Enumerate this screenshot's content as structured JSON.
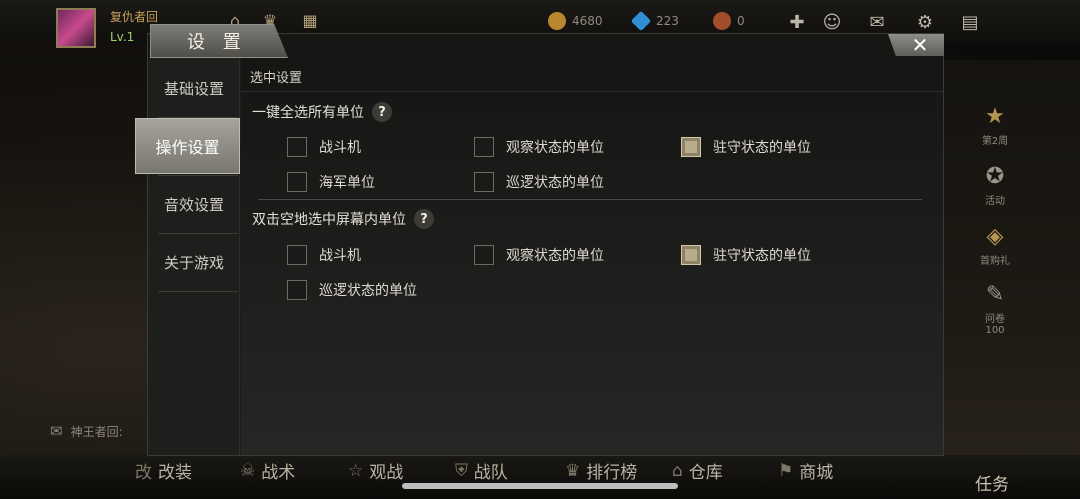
{
  "player": {
    "name": "复仇者回",
    "level": "Lv.1"
  },
  "resources": {
    "gold": "4680",
    "gems": "223",
    "medals": "0"
  },
  "settings": {
    "title": "设 置",
    "close_label": "✕",
    "nav": [
      "基础设置",
      "操作设置",
      "音效设置",
      "关于游戏"
    ],
    "active_nav": "操作设置",
    "section_title": "选中设置",
    "group1": {
      "title": "一键全选所有单位",
      "help": "?",
      "options": [
        {
          "label": "战斗机",
          "checked": false
        },
        {
          "label": "观察状态的单位",
          "checked": false
        },
        {
          "label": "驻守状态的单位",
          "checked": true
        },
        {
          "label": "海军单位",
          "checked": false
        },
        {
          "label": "巡逻状态的单位",
          "checked": false
        }
      ]
    },
    "group2": {
      "title": "双击空地选中屏幕内单位",
      "help": "?",
      "options": [
        {
          "label": "战斗机",
          "checked": false
        },
        {
          "label": "观察状态的单位",
          "checked": false
        },
        {
          "label": "驻守状态的单位",
          "checked": true
        },
        {
          "label": "巡逻状态的单位",
          "checked": false
        }
      ]
    }
  },
  "side": [
    "第2周",
    "活动",
    "首购礼",
    "问卷"
  ],
  "side_count": "100",
  "chat_label": "神王者回:",
  "bottom_nav": [
    {
      "icon": "改",
      "label": "改装"
    },
    {
      "icon": "☠",
      "label": "战术"
    },
    {
      "icon": "☆",
      "label": "观战"
    },
    {
      "icon": "⛨",
      "label": "战队"
    },
    {
      "icon": "♛",
      "label": "排行榜"
    },
    {
      "icon": "⌂",
      "label": "仓库"
    },
    {
      "icon": "⚑",
      "label": "商城"
    }
  ],
  "mission_label": "任务",
  "colors": {
    "accent": "#b8ac8a",
    "panel": "#1c1c1b",
    "tab": "#8e8d87"
  }
}
